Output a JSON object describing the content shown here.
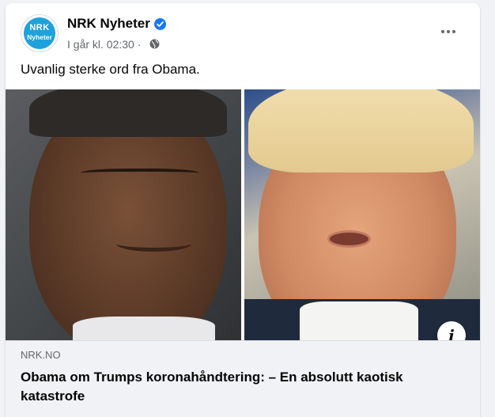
{
  "post": {
    "page_name": "NRK Nyheter",
    "avatar_logo": "NRK",
    "avatar_sub": "Nyheter",
    "timestamp": "I går kl. 02:30 ·",
    "text": "Uvanlig sterke ord fra Obama.",
    "more_icon": "more-horizontal-icon",
    "verified_icon": "verified-check-icon",
    "privacy_icon": "globe-icon"
  },
  "link": {
    "domain": "NRK.NO",
    "title": "Obama om Trumps koronahåndtering: – En absolutt kaotisk katastrofe",
    "info_icon": "info-icon"
  },
  "colors": {
    "brand_blue": "#1fa1dc",
    "verified_blue": "#1877f2",
    "text_secondary": "#65676b",
    "preview_bg": "#f0f2f5"
  }
}
